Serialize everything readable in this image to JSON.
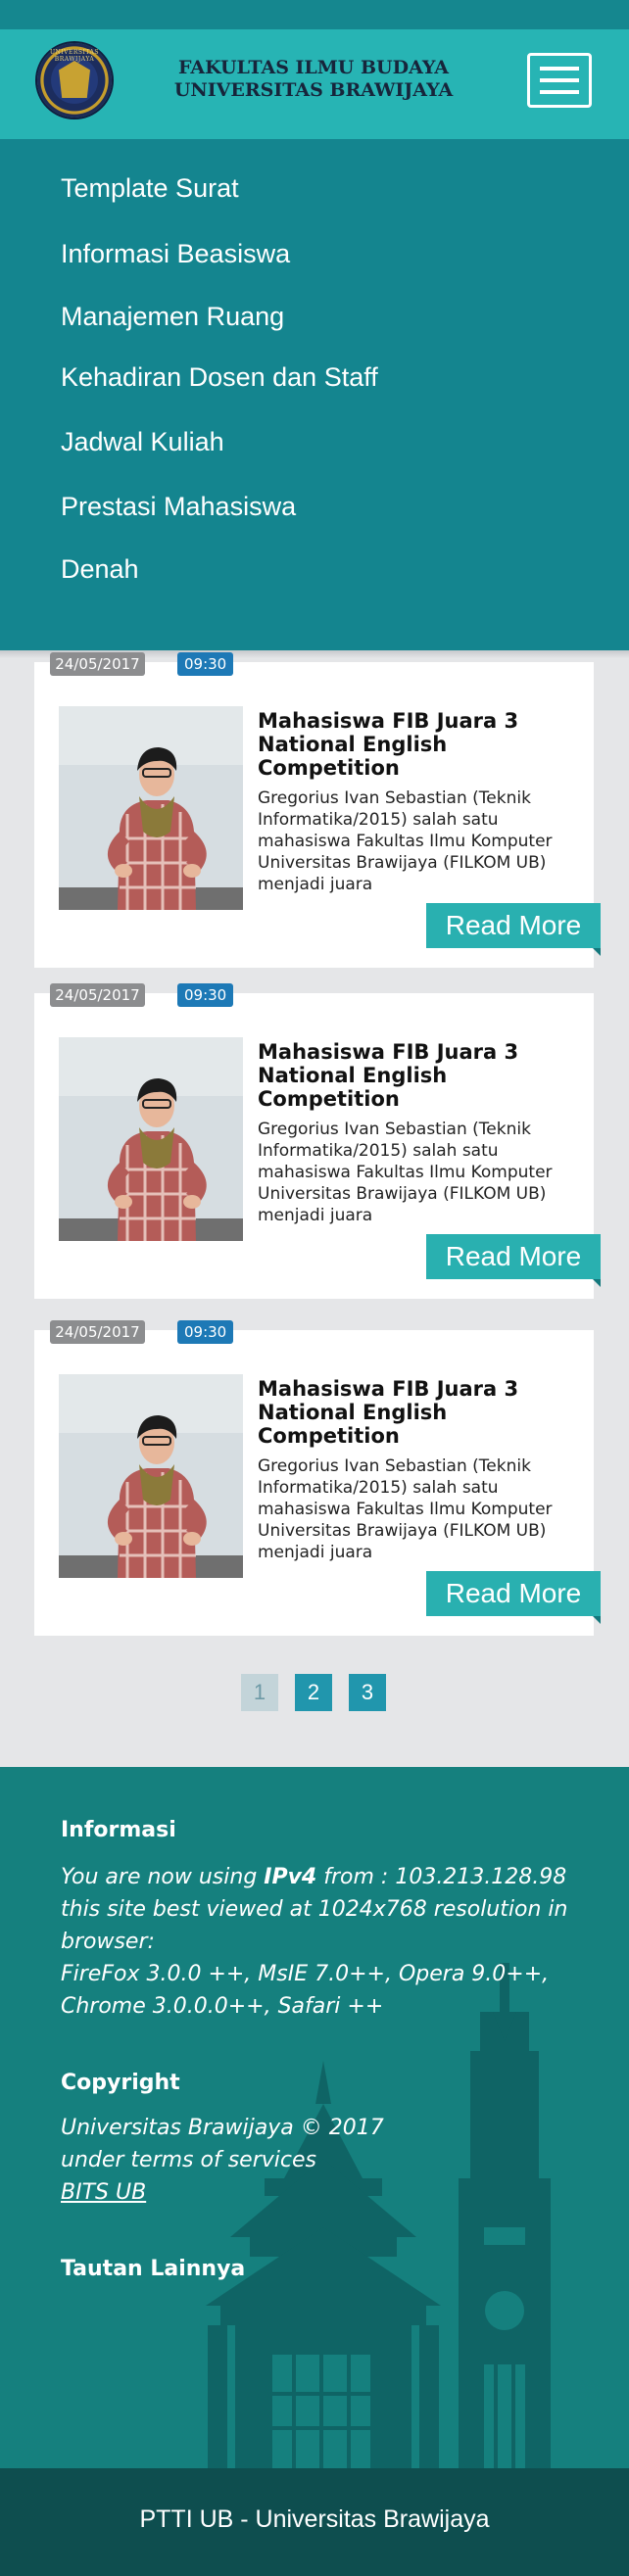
{
  "header": {
    "title_line1": "FAKULTAS ILMU BUDAYA",
    "title_line2": "UNIVERSITAS BRAWIJAYA",
    "logo_text": "UNIVERSITAS BRAWIJAYA",
    "menu_icon": "hamburger-icon"
  },
  "nav": {
    "items": [
      {
        "label": "Template Surat"
      },
      {
        "label": "Informasi Beasiswa"
      },
      {
        "label": "Manajemen Ruang"
      },
      {
        "label": "Kehadiran Dosen dan Staff"
      },
      {
        "label": "Jadwal Kuliah"
      },
      {
        "label": "Prestasi Mahasiswa"
      },
      {
        "label": "Denah"
      }
    ]
  },
  "news": [
    {
      "date": "24/05/2017",
      "time": "09:30",
      "title": "Mahasiswa FIB Juara 3 National English Competition",
      "summary": "Gregorius Ivan Sebastian (Teknik Informatika/2015) salah satu mahasiswa Fakultas Ilmu Komputer Universitas Brawijaya (FILKOM UB) menjadi juara",
      "read_more": "Read More"
    },
    {
      "date": "24/05/2017",
      "time": "09:30",
      "title": "Mahasiswa FIB Juara 3 National English Competition",
      "summary": "Gregorius Ivan Sebastian (Teknik Informatika/2015) salah satu mahasiswa Fakultas Ilmu Komputer Universitas Brawijaya (FILKOM UB) menjadi juara",
      "read_more": "Read More"
    },
    {
      "date": "24/05/2017",
      "time": "09:30",
      "title": "Mahasiswa FIB Juara 3 National English Competition",
      "summary": "Gregorius Ivan Sebastian (Teknik Informatika/2015) salah satu mahasiswa Fakultas Ilmu Komputer Universitas Brawijaya (FILKOM UB) menjadi juara",
      "read_more": "Read More"
    }
  ],
  "pagination": {
    "pages": [
      "1",
      "2",
      "3"
    ],
    "current": "1"
  },
  "footer": {
    "info_heading": "Informasi",
    "info_line1_prefix": "You are now using ",
    "info_ip_version": "IPv4",
    "info_line1_suffix": " from : 103.213.128.98",
    "info_line2": "this site best viewed at 1024x768 resolution in",
    "info_line3": "browser:",
    "info_line4": "FireFox 3.0.0 ++, MsIE 7.0++, Opera 9.0++,",
    "info_line5": "Chrome 3.0.0.0++, Safari ++",
    "copyright_heading": "Copyright",
    "copyright_line1": "Universitas Brawijaya © 2017",
    "copyright_line2": "under terms of services",
    "copyright_link": "BITS UB",
    "links_heading": "Tautan Lainnya",
    "bottom_text": "PTTI UB  - Universitas Brawijaya"
  },
  "colors": {
    "header": "#27b4b4",
    "nav": "#14858f",
    "footer": "#15807e",
    "bottom_bar": "#0e4e4f",
    "accent": "#29b0b0",
    "time_badge": "#1d79b6",
    "date_badge": "#8c8d8f"
  }
}
